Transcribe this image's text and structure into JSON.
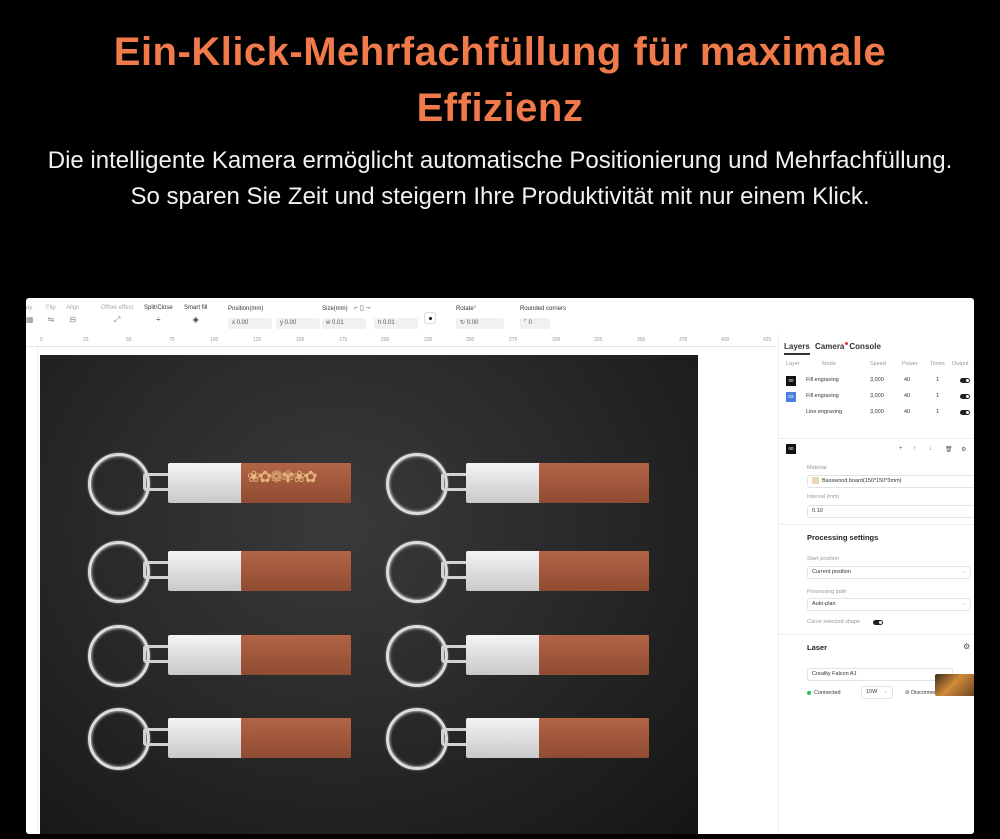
{
  "hero": {
    "title": "Ein-Klick-Mehrfachfüllung für maximale Effizienz",
    "subtitle": "Die intelligente Kamera ermöglicht automatische Positionierung und Mehrfachfüllung. So sparen Sie Zeit und steigern Ihre Produktivität mit nur einem Klick."
  },
  "toolbar": {
    "array_label": "ay",
    "flip_label": "Flip",
    "align_label": "Align",
    "offset_label": "Offset effect",
    "split_label": "Split/Close",
    "smartfill_label": "Smart fill",
    "position_label": "Position(mm)",
    "pos_x": "x 0.00",
    "pos_y": "y 0.00",
    "size_label": "Size(mm)",
    "size_w": "w 0.01",
    "size_h": "h 0.01",
    "rotate_label": "Rotate°",
    "rotate_value": "0.00",
    "rounded_label": "Rounded corners",
    "rounded_value": "0"
  },
  "ruler": [
    "0",
    "25",
    "50",
    "75",
    "100",
    "125",
    "150",
    "175",
    "200",
    "225",
    "250",
    "275",
    "300",
    "325",
    "350",
    "375",
    "400",
    "425"
  ],
  "canvas": {
    "engraving_pattern": "❀✿❁✾❀✿"
  },
  "panel": {
    "tabs": [
      "Layers",
      "Camera",
      "Console"
    ],
    "layer_columns": [
      "Layer",
      "Mode",
      "Speed",
      "Power",
      "Times",
      "Output"
    ],
    "layers": [
      {
        "id": "00",
        "color": "#111111",
        "mode": "Fill engraving",
        "speed": "3,000",
        "power": "40",
        "times": "1"
      },
      {
        "id": "02",
        "color": "#4a7fe0",
        "mode": "Fill engraving",
        "speed": "3,000",
        "power": "40",
        "times": "1"
      },
      {
        "id": "",
        "color": "#ffffff",
        "mode": "Line engraving",
        "speed": "3,000",
        "power": "40",
        "times": "1"
      }
    ],
    "selected_layer": "00",
    "material_label": "Material",
    "material_value": "Basswood board(150*150*3mm)",
    "interval_label": "Interval (mm)",
    "interval_value": "0.10",
    "processing_title": "Processing settings",
    "start_position_label": "Start position",
    "start_position_value": "Current position",
    "processing_path_label": "Processing path",
    "processing_path_value": "Auto-plan",
    "carve_label": "Carve selected shape",
    "laser_title": "Laser",
    "device_value": "Creality Falcon A1",
    "status_text": "Connected",
    "power_value": "10W",
    "disconnect_label": "Disconnect"
  }
}
